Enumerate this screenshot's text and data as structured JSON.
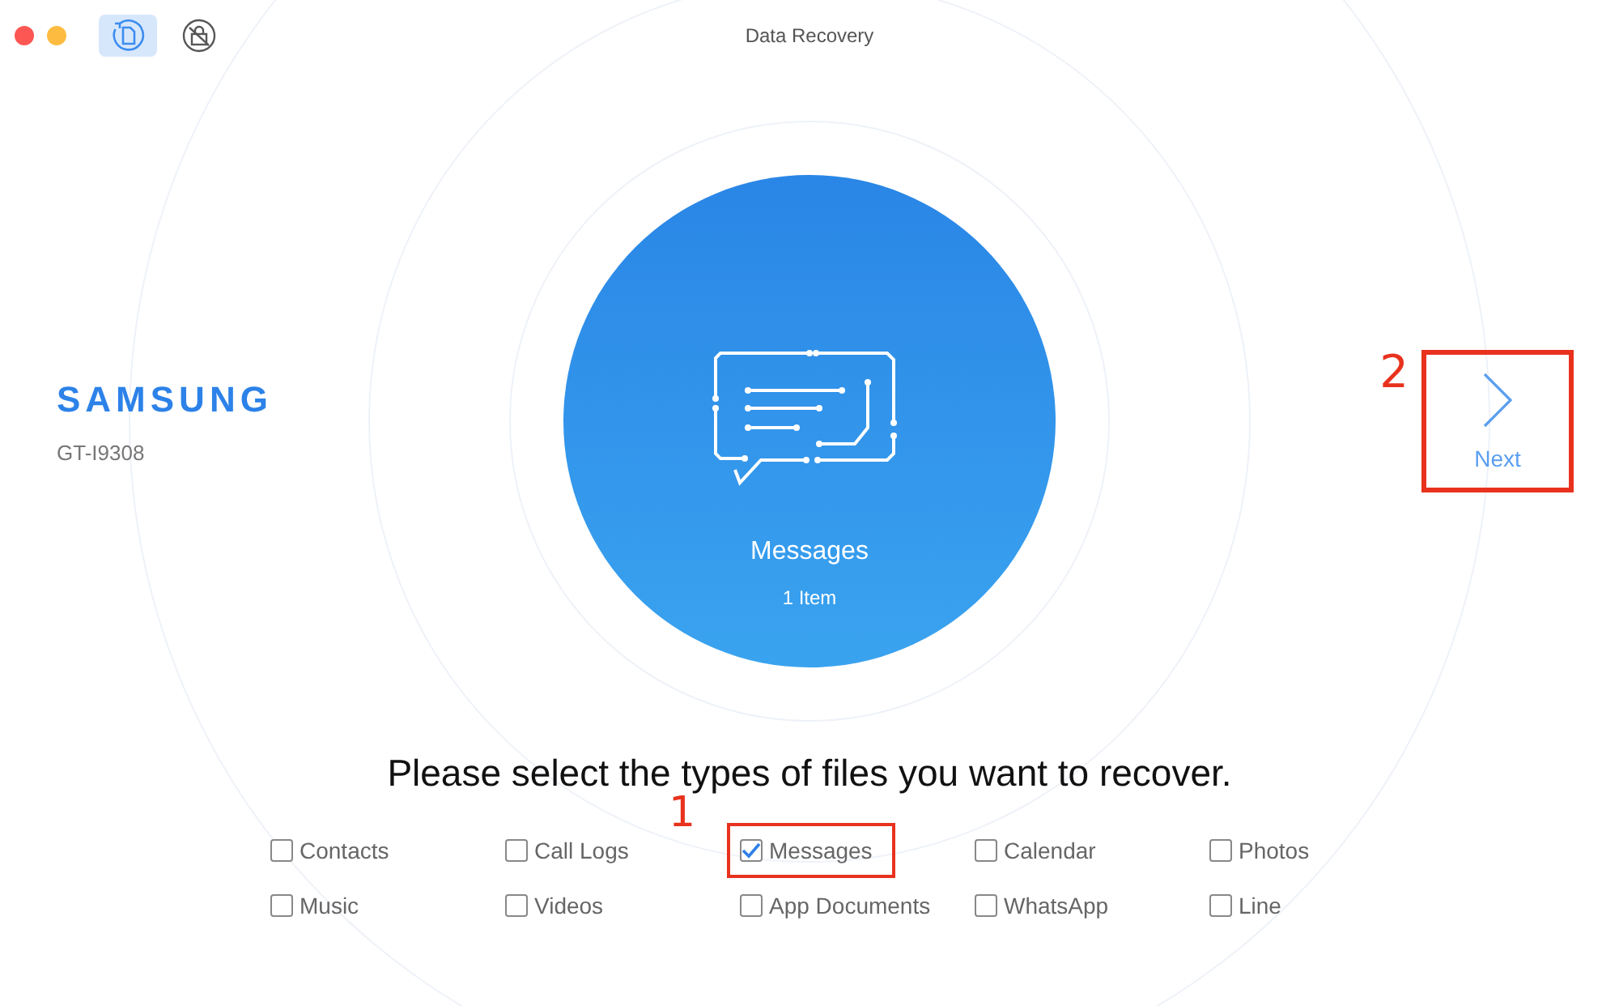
{
  "window": {
    "title": "Data Recovery",
    "toolbar": [
      {
        "kind": "recover",
        "selected": true
      },
      {
        "kind": "lock",
        "selected": false
      }
    ]
  },
  "device": {
    "brand": "SAMSUNG",
    "model": "GT-I9308"
  },
  "preview": {
    "title": "Messages",
    "count": "1 Item"
  },
  "next": {
    "label": "Next",
    "annotation": "2"
  },
  "prompt": "Please select the types of files you want to recover.",
  "options": [
    {
      "label": "Contacts",
      "checked": false
    },
    {
      "label": "Call Logs",
      "checked": false
    },
    {
      "label": "Messages",
      "checked": true,
      "annotation": "1"
    },
    {
      "label": "Calendar",
      "checked": false
    },
    {
      "label": "Photos",
      "checked": false
    },
    {
      "label": "Music",
      "checked": false
    },
    {
      "label": "Videos",
      "checked": false
    },
    {
      "label": "App Documents",
      "checked": false
    },
    {
      "label": "WhatsApp",
      "checked": false
    },
    {
      "label": "Line",
      "checked": false
    }
  ]
}
